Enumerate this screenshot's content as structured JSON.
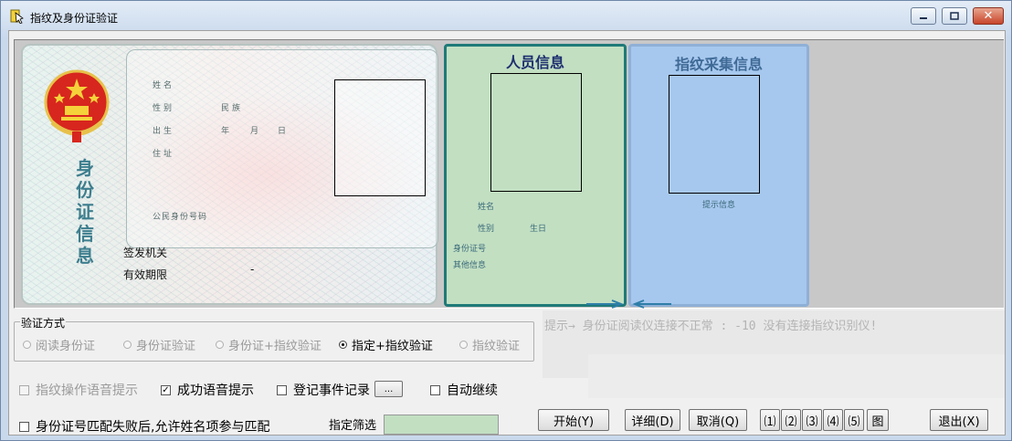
{
  "window": {
    "title": "指纹及身份证验证",
    "close_glyph": "✕"
  },
  "id_card": {
    "vertical_title": "身份证信息",
    "fields": {
      "name": "姓名",
      "sex": "性别",
      "ethnicity": "民族",
      "birth": "出生",
      "year": "年",
      "month": "月",
      "day": "日",
      "address": "住址",
      "id_number": "公民身份号码"
    },
    "issuer_label": "签发机关",
    "validity_label": "有效期限",
    "validity_value": "-"
  },
  "person_info": {
    "title": "人员信息",
    "name_label": "姓名",
    "sex_label": "性别",
    "birthday_label": "生日",
    "id_label": "身份证号",
    "other_label": "其他信息"
  },
  "fingerprint_info": {
    "title": "指纹采集信息",
    "hint_label": "提示信息"
  },
  "verify_mode": {
    "legend": "验证方式",
    "options": [
      {
        "label": "阅读身份证",
        "selected": false
      },
      {
        "label": "身份证验证",
        "selected": false
      },
      {
        "label": "身份证+指纹验证",
        "selected": false
      },
      {
        "label": "指定+指纹验证",
        "selected": true
      },
      {
        "label": "指纹验证",
        "selected": false
      }
    ]
  },
  "status": {
    "text": "提示→ 身份证阅读仪连接不正常 : -10  没有连接指纹识别仪!"
  },
  "options": {
    "fp_voice": {
      "label": "指纹操作语音提示",
      "checked": false,
      "enabled": false
    },
    "success_voice": {
      "label": "成功语音提示",
      "checked": true,
      "enabled": true
    },
    "log_events": {
      "label": "登记事件记录",
      "checked": false,
      "enabled": true
    },
    "log_browse": "...",
    "auto_continue": {
      "label": "自动继续",
      "checked": false,
      "enabled": true
    },
    "allow_name_match": {
      "label": "身份证号匹配失败后,允许姓名项参与匹配",
      "checked": false,
      "enabled": true
    }
  },
  "filter": {
    "label": "指定筛选",
    "value": ""
  },
  "buttons": {
    "start": "开始(Y)",
    "details": "详细(D)",
    "cancel": "取消(Q)",
    "n1": "⑴",
    "n2": "⑵",
    "n3": "⑶",
    "n4": "⑷",
    "n5": "⑸",
    "image": "图",
    "exit": "退出(X)"
  },
  "colors": {
    "person_panel": "#c2dfc2",
    "person_border": "#1f7a78",
    "fingerprint_panel": "#a7c8ee",
    "accent_title": "#1d2f6f"
  }
}
